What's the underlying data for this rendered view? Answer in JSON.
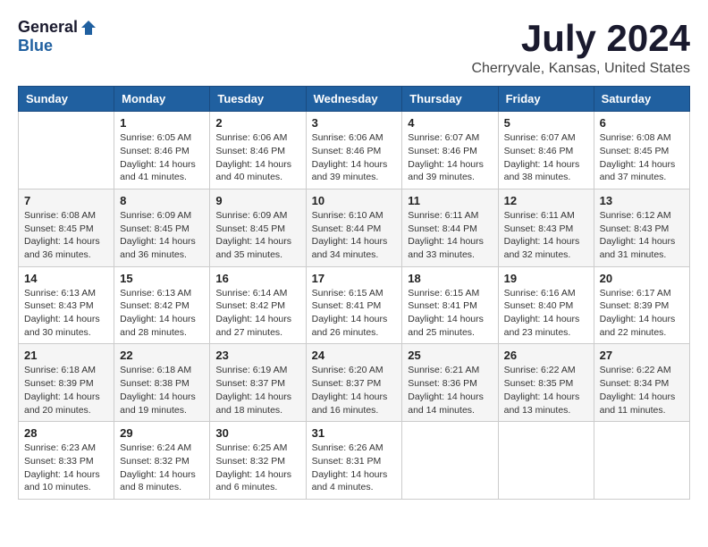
{
  "header": {
    "logo_general": "General",
    "logo_blue": "Blue",
    "title": "July 2024",
    "subtitle": "Cherryvale, Kansas, United States"
  },
  "calendar": {
    "days": [
      "Sunday",
      "Monday",
      "Tuesday",
      "Wednesday",
      "Thursday",
      "Friday",
      "Saturday"
    ],
    "weeks": [
      [
        {
          "num": "",
          "text": ""
        },
        {
          "num": "1",
          "text": "Sunrise: 6:05 AM\nSunset: 8:46 PM\nDaylight: 14 hours\nand 41 minutes."
        },
        {
          "num": "2",
          "text": "Sunrise: 6:06 AM\nSunset: 8:46 PM\nDaylight: 14 hours\nand 40 minutes."
        },
        {
          "num": "3",
          "text": "Sunrise: 6:06 AM\nSunset: 8:46 PM\nDaylight: 14 hours\nand 39 minutes."
        },
        {
          "num": "4",
          "text": "Sunrise: 6:07 AM\nSunset: 8:46 PM\nDaylight: 14 hours\nand 39 minutes."
        },
        {
          "num": "5",
          "text": "Sunrise: 6:07 AM\nSunset: 8:46 PM\nDaylight: 14 hours\nand 38 minutes."
        },
        {
          "num": "6",
          "text": "Sunrise: 6:08 AM\nSunset: 8:45 PM\nDaylight: 14 hours\nand 37 minutes."
        }
      ],
      [
        {
          "num": "7",
          "text": "Sunrise: 6:08 AM\nSunset: 8:45 PM\nDaylight: 14 hours\nand 36 minutes."
        },
        {
          "num": "8",
          "text": "Sunrise: 6:09 AM\nSunset: 8:45 PM\nDaylight: 14 hours\nand 36 minutes."
        },
        {
          "num": "9",
          "text": "Sunrise: 6:09 AM\nSunset: 8:45 PM\nDaylight: 14 hours\nand 35 minutes."
        },
        {
          "num": "10",
          "text": "Sunrise: 6:10 AM\nSunset: 8:44 PM\nDaylight: 14 hours\nand 34 minutes."
        },
        {
          "num": "11",
          "text": "Sunrise: 6:11 AM\nSunset: 8:44 PM\nDaylight: 14 hours\nand 33 minutes."
        },
        {
          "num": "12",
          "text": "Sunrise: 6:11 AM\nSunset: 8:43 PM\nDaylight: 14 hours\nand 32 minutes."
        },
        {
          "num": "13",
          "text": "Sunrise: 6:12 AM\nSunset: 8:43 PM\nDaylight: 14 hours\nand 31 minutes."
        }
      ],
      [
        {
          "num": "14",
          "text": "Sunrise: 6:13 AM\nSunset: 8:43 PM\nDaylight: 14 hours\nand 30 minutes."
        },
        {
          "num": "15",
          "text": "Sunrise: 6:13 AM\nSunset: 8:42 PM\nDaylight: 14 hours\nand 28 minutes."
        },
        {
          "num": "16",
          "text": "Sunrise: 6:14 AM\nSunset: 8:42 PM\nDaylight: 14 hours\nand 27 minutes."
        },
        {
          "num": "17",
          "text": "Sunrise: 6:15 AM\nSunset: 8:41 PM\nDaylight: 14 hours\nand 26 minutes."
        },
        {
          "num": "18",
          "text": "Sunrise: 6:15 AM\nSunset: 8:41 PM\nDaylight: 14 hours\nand 25 minutes."
        },
        {
          "num": "19",
          "text": "Sunrise: 6:16 AM\nSunset: 8:40 PM\nDaylight: 14 hours\nand 23 minutes."
        },
        {
          "num": "20",
          "text": "Sunrise: 6:17 AM\nSunset: 8:39 PM\nDaylight: 14 hours\nand 22 minutes."
        }
      ],
      [
        {
          "num": "21",
          "text": "Sunrise: 6:18 AM\nSunset: 8:39 PM\nDaylight: 14 hours\nand 20 minutes."
        },
        {
          "num": "22",
          "text": "Sunrise: 6:18 AM\nSunset: 8:38 PM\nDaylight: 14 hours\nand 19 minutes."
        },
        {
          "num": "23",
          "text": "Sunrise: 6:19 AM\nSunset: 8:37 PM\nDaylight: 14 hours\nand 18 minutes."
        },
        {
          "num": "24",
          "text": "Sunrise: 6:20 AM\nSunset: 8:37 PM\nDaylight: 14 hours\nand 16 minutes."
        },
        {
          "num": "25",
          "text": "Sunrise: 6:21 AM\nSunset: 8:36 PM\nDaylight: 14 hours\nand 14 minutes."
        },
        {
          "num": "26",
          "text": "Sunrise: 6:22 AM\nSunset: 8:35 PM\nDaylight: 14 hours\nand 13 minutes."
        },
        {
          "num": "27",
          "text": "Sunrise: 6:22 AM\nSunset: 8:34 PM\nDaylight: 14 hours\nand 11 minutes."
        }
      ],
      [
        {
          "num": "28",
          "text": "Sunrise: 6:23 AM\nSunset: 8:33 PM\nDaylight: 14 hours\nand 10 minutes."
        },
        {
          "num": "29",
          "text": "Sunrise: 6:24 AM\nSunset: 8:32 PM\nDaylight: 14 hours\nand 8 minutes."
        },
        {
          "num": "30",
          "text": "Sunrise: 6:25 AM\nSunset: 8:32 PM\nDaylight: 14 hours\nand 6 minutes."
        },
        {
          "num": "31",
          "text": "Sunrise: 6:26 AM\nSunset: 8:31 PM\nDaylight: 14 hours\nand 4 minutes."
        },
        {
          "num": "",
          "text": ""
        },
        {
          "num": "",
          "text": ""
        },
        {
          "num": "",
          "text": ""
        }
      ]
    ]
  }
}
